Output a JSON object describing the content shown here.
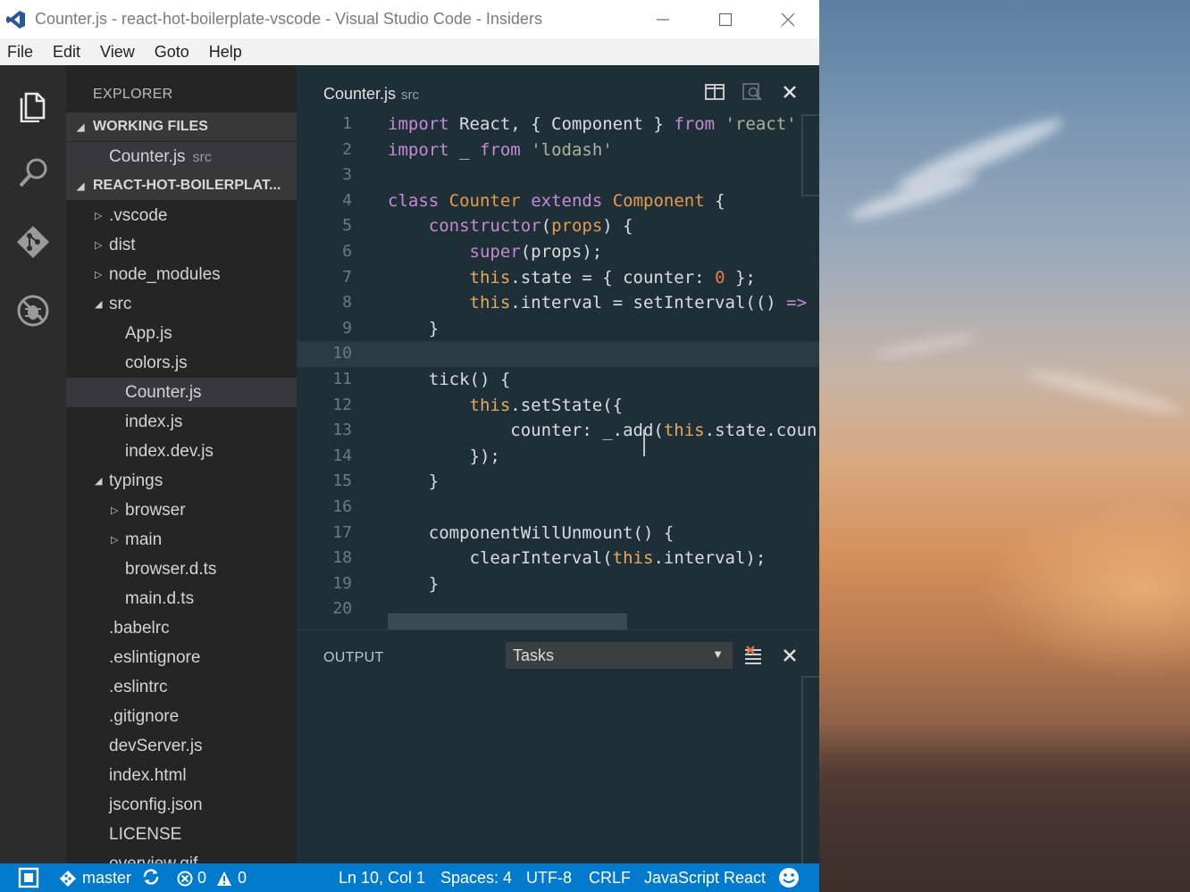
{
  "window": {
    "title": "Counter.js - react-hot-boilerplate-vscode - Visual Studio Code - Insiders",
    "minimize_icon": "minimize-icon",
    "maximize_icon": "maximize-icon",
    "close_icon": "close-icon"
  },
  "menu": [
    "File",
    "Edit",
    "View",
    "Goto",
    "Help"
  ],
  "activity_bar": [
    "explorer-icon",
    "search-icon",
    "git-icon",
    "debug-icon"
  ],
  "explorer": {
    "title": "EXPLORER",
    "working_files_label": "WORKING FILES",
    "working_files": [
      {
        "name": "Counter.js",
        "desc": "src"
      }
    ],
    "project_label": "REACT-HOT-BOILERPLAT...",
    "tree": [
      {
        "name": ".vscode",
        "type": "folder",
        "expanded": false
      },
      {
        "name": "dist",
        "type": "folder",
        "expanded": false
      },
      {
        "name": "node_modules",
        "type": "folder",
        "expanded": false
      },
      {
        "name": "src",
        "type": "folder",
        "expanded": true
      },
      {
        "name": "App.js",
        "type": "file"
      },
      {
        "name": "colors.js",
        "type": "file"
      },
      {
        "name": "Counter.js",
        "type": "file",
        "selected": true
      },
      {
        "name": "index.js",
        "type": "file"
      },
      {
        "name": "index.dev.js",
        "type": "file"
      },
      {
        "name": "typings",
        "type": "folder",
        "expanded": true
      },
      {
        "name": "browser",
        "type": "folder",
        "expanded": false
      },
      {
        "name": "main",
        "type": "folder",
        "expanded": false
      },
      {
        "name": "browser.d.ts",
        "type": "file"
      },
      {
        "name": "main.d.ts",
        "type": "file"
      },
      {
        "name": ".babelrc",
        "type": "file"
      },
      {
        "name": ".eslintignore",
        "type": "file"
      },
      {
        "name": ".eslintrc",
        "type": "file"
      },
      {
        "name": ".gitignore",
        "type": "file"
      },
      {
        "name": "devServer.js",
        "type": "file"
      },
      {
        "name": "index.html",
        "type": "file"
      },
      {
        "name": "jsconfig.json",
        "type": "file"
      },
      {
        "name": "LICENSE",
        "type": "file"
      },
      {
        "name": "overview.gif",
        "type": "file"
      }
    ]
  },
  "editor": {
    "tab_name": "Counter.js",
    "tab_desc": "src",
    "split_icon": "split-editor-icon",
    "preview_icon": "open-preview-icon",
    "close_icon": "close-editor-icon",
    "line_numbers": [
      "1",
      "2",
      "3",
      "4",
      "5",
      "6",
      "7",
      "8",
      "9",
      "10",
      "11",
      "12",
      "13",
      "14",
      "15",
      "16",
      "17",
      "18",
      "19",
      "20"
    ],
    "current_line": 10
  },
  "panel": {
    "title": "OUTPUT",
    "select_value": "Tasks",
    "clear_icon": "clear-output-icon",
    "close_icon": "close-panel-icon"
  },
  "status": {
    "branch": "master",
    "errors": "0",
    "warnings": "0",
    "position": "Ln 10, Col 1",
    "spaces": "Spaces: 4",
    "encoding": "UTF-8",
    "eol": "CRLF",
    "language": "JavaScript React"
  },
  "colors": {
    "status_bar": "#007acc",
    "editor_bg": "#1f2f38",
    "sidebar_bg": "#252526",
    "activity_bar": "#2c2c2c"
  }
}
